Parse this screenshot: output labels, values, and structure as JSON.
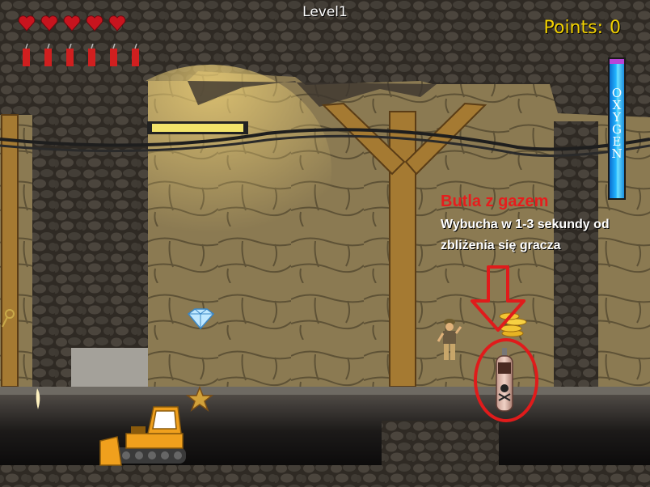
{
  "hud": {
    "level": "Level1",
    "points_label": "Points:",
    "points_value": "0",
    "lives": 5,
    "dynamite": 6,
    "oxygen_label": "OXYGEN",
    "oxygen_level": 1.0
  },
  "tooltip": {
    "title": "Butla z gazem",
    "line1": "Wybucha w 1-3 sekundy od",
    "line2": "zbliżenia się gracza"
  },
  "colors": {
    "heart": "#c8141e",
    "dynamite": "#d01f1f",
    "points": "#f2d100",
    "oxygen": "#23b6ff",
    "tooltip_title": "#e61d1d",
    "highlight": "#e01b1b"
  },
  "objects": {
    "gem": "diamond-icon",
    "coins": "gold-coins-icon",
    "star": "star-icon",
    "gas_bottle": "gas-bottle-icon",
    "bulldozer": "bulldozer-icon",
    "player": "miner-character",
    "key": "key-icon",
    "lamp": "ceiling-lamp"
  }
}
